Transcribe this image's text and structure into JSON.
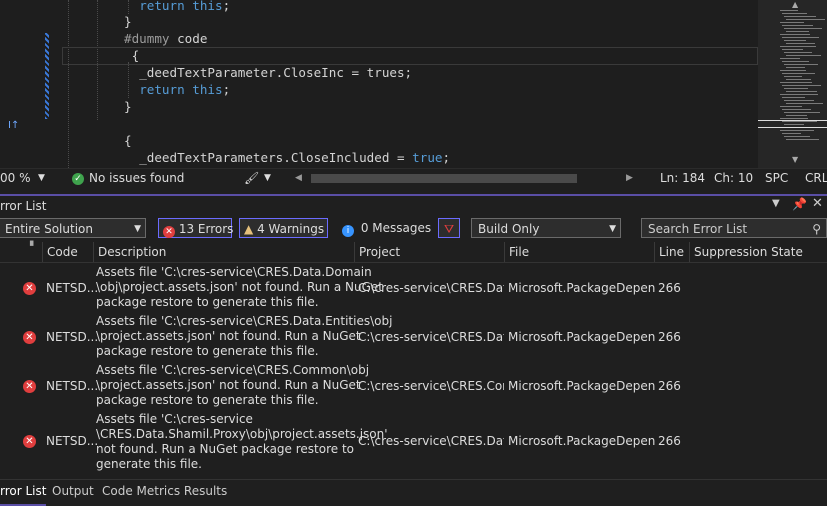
{
  "editor": {
    "lines": [
      {
        "indent": "                ",
        "parts": [
          {
            "t": "return ",
            "c": "kw"
          },
          {
            "t": "this",
            "c": "kw"
          },
          {
            "t": ";",
            "c": ""
          }
        ]
      },
      {
        "indent": "            ",
        "parts": [
          {
            "t": "}",
            "c": ""
          }
        ]
      },
      {
        "indent": "            ",
        "parts": [
          {
            "t": "#dummy ",
            "c": "pre"
          },
          {
            "t": "code",
            "c": ""
          }
        ]
      },
      {
        "indent": "              ",
        "parts": [
          {
            "t": "{",
            "c": ""
          }
        ]
      },
      {
        "indent": "                ",
        "parts": [
          {
            "t": "_deedTextParameter.CloseInc = trues;",
            "c": ""
          }
        ]
      },
      {
        "indent": "                ",
        "parts": [
          {
            "t": "return ",
            "c": "kw"
          },
          {
            "t": "this",
            "c": "kw"
          },
          {
            "t": ";",
            "c": ""
          }
        ]
      },
      {
        "indent": "            ",
        "parts": [
          {
            "t": "}",
            "c": ""
          }
        ]
      },
      {
        "indent": "",
        "parts": []
      },
      {
        "indent": "            ",
        "parts": [
          {
            "t": "{",
            "c": ""
          }
        ]
      },
      {
        "indent": "                ",
        "parts": [
          {
            "t": "_deedTextParameters.CloseIncluded = ",
            "c": ""
          },
          {
            "t": "true",
            "c": "kw"
          },
          {
            "t": ";",
            "c": ""
          }
        ]
      }
    ]
  },
  "status": {
    "zoom": "00 %",
    "issues": "No issues found",
    "ln": "Ln: 184",
    "ch": "Ch: 10",
    "spc": "SPC",
    "eol": "CRLF"
  },
  "panel": {
    "title": "rror List",
    "scope": "Entire Solution",
    "errors": "13 Errors",
    "warnings": "4 Warnings",
    "messages": "0 Messages",
    "build": "Build Only",
    "search_placeholder": "Search Error List"
  },
  "columns": [
    "Code",
    "Description",
    "Project",
    "File",
    "Line",
    "Suppression State"
  ],
  "rows": [
    {
      "code": "NETSD...",
      "desc": "Assets file 'C:\\cres-service\\CRES.Data.Domain\n\\obj\\project.assets.json' not found. Run a NuGet\npackage restore to generate this file.",
      "project": "C:\\cres-service\\CRES.Data...",
      "file": "Microsoft.PackageDepend...",
      "line": "266"
    },
    {
      "code": "NETSD...",
      "desc": "Assets file 'C:\\cres-service\\CRES.Data.Entities\\obj\n\\project.assets.json' not found. Run a NuGet\npackage restore to generate this file.",
      "project": "C:\\cres-service\\CRES.Data...",
      "file": "Microsoft.PackageDepend...",
      "line": "266"
    },
    {
      "code": "NETSD...",
      "desc": "Assets file 'C:\\cres-service\\CRES.Common\\obj\n\\project.assets.json' not found. Run a NuGet\npackage restore to generate this file.",
      "project": "C:\\cres-service\\CRES.Com...",
      "file": "Microsoft.PackageDepend...",
      "line": "266"
    },
    {
      "code": "NETSD...",
      "desc": "Assets file 'C:\\cres-service\n\\CRES.Data.Shamil.Proxy\\obj\\project.assets.json'\nnot found. Run a NuGet package restore to\ngenerate this file.",
      "project": "C:\\cres-service\\CRES.Data...",
      "file": "Microsoft.PackageDepend...",
      "line": "266"
    }
  ],
  "bottom_tabs": [
    "rror List",
    "Output",
    "Code Metrics Results"
  ],
  "colors": {
    "accent": "#5a4ea6",
    "error": "#e03e3e",
    "warning": "#e5c07b",
    "info": "#3794ff"
  }
}
